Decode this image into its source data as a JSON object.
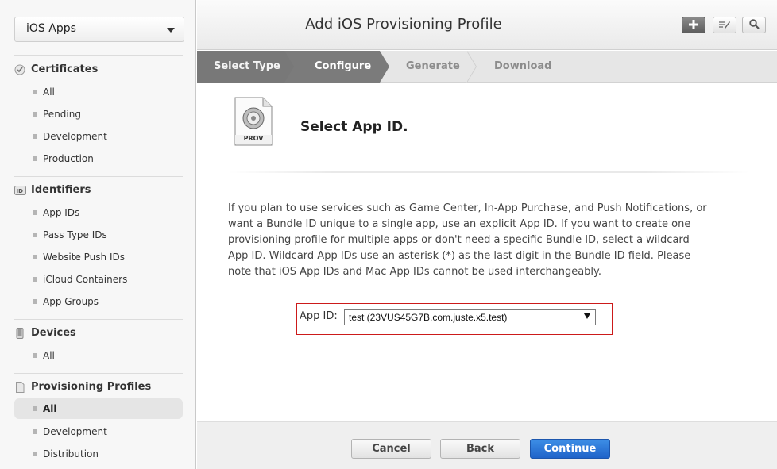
{
  "sidebar": {
    "platform": "iOS Apps",
    "sections": [
      {
        "title": "Certificates",
        "icon": "certificate-icon",
        "items": [
          "All",
          "Pending",
          "Development",
          "Production"
        ]
      },
      {
        "title": "Identifiers",
        "icon": "id-badge-icon",
        "items": [
          "App IDs",
          "Pass Type IDs",
          "Website Push IDs",
          "iCloud Containers",
          "App Groups"
        ]
      },
      {
        "title": "Devices",
        "icon": "device-icon",
        "items": [
          "All"
        ]
      },
      {
        "title": "Provisioning Profiles",
        "icon": "document-icon",
        "items": [
          "All",
          "Development",
          "Distribution"
        ]
      }
    ]
  },
  "header": {
    "title": "Add iOS Provisioning Profile",
    "buttons": [
      "add-icon",
      "edit-icon",
      "search-icon"
    ]
  },
  "steps": [
    "Select Type",
    "Configure",
    "Generate",
    "Download"
  ],
  "main": {
    "icon_label": "PROV",
    "section_title": "Select App ID.",
    "description": "If you plan to use services such as Game Center, In-App Purchase, and Push Notifications, or want a Bundle ID unique to a single app, use an explicit App ID. If you want to create one provisioning profile for multiple apps or don't need a specific Bundle ID, select a wildcard App ID. Wildcard App IDs use an asterisk (*) as the last digit in the Bundle ID field. Please note that iOS App IDs and Mac App IDs cannot be used interchangeably.",
    "app_id_label": "App ID:",
    "app_id_value": "test (23VUS45G7B.com.juste.x5.test)"
  },
  "footer": {
    "cancel": "Cancel",
    "back": "Back",
    "continue": "Continue"
  },
  "colors": {
    "primary_button": "#2a74d6",
    "highlight_border": "#cc1a1a",
    "step_active": "#787878"
  }
}
